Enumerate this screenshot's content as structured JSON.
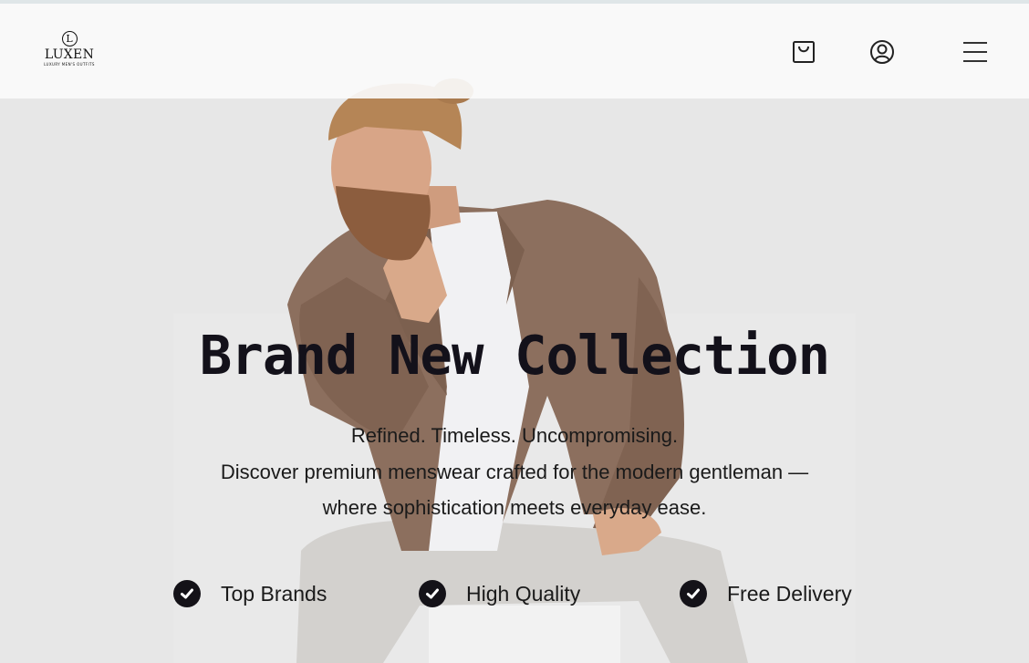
{
  "header": {
    "logo": {
      "mark": "L",
      "name": "LUXEN",
      "tagline": "LUXURY MEN'S OUTFITS"
    },
    "icons": {
      "cart": "shopping-bag-icon",
      "account": "user-circle-icon",
      "menu": "hamburger-menu-icon"
    }
  },
  "hero": {
    "headline": "Brand New Collection",
    "subtitle_line1": "Refined. Timeless. Uncompromising.",
    "subtitle_line2": "Discover premium menswear crafted for the modern gentleman —",
    "subtitle_line3": "where sophistication meets everyday ease.",
    "features": [
      {
        "label": "Top Brands",
        "icon": "check-circle-icon"
      },
      {
        "label": "High Quality",
        "icon": "check-circle-icon"
      },
      {
        "label": "Free Delivery",
        "icon": "check-circle-icon"
      }
    ]
  },
  "colors": {
    "background": "#e7e7e7",
    "header": "#fafafa",
    "text": "#13111a",
    "jacket": "#8c6f5e",
    "shirt": "#f2f2f4",
    "trousers": "#d4d2cf"
  }
}
